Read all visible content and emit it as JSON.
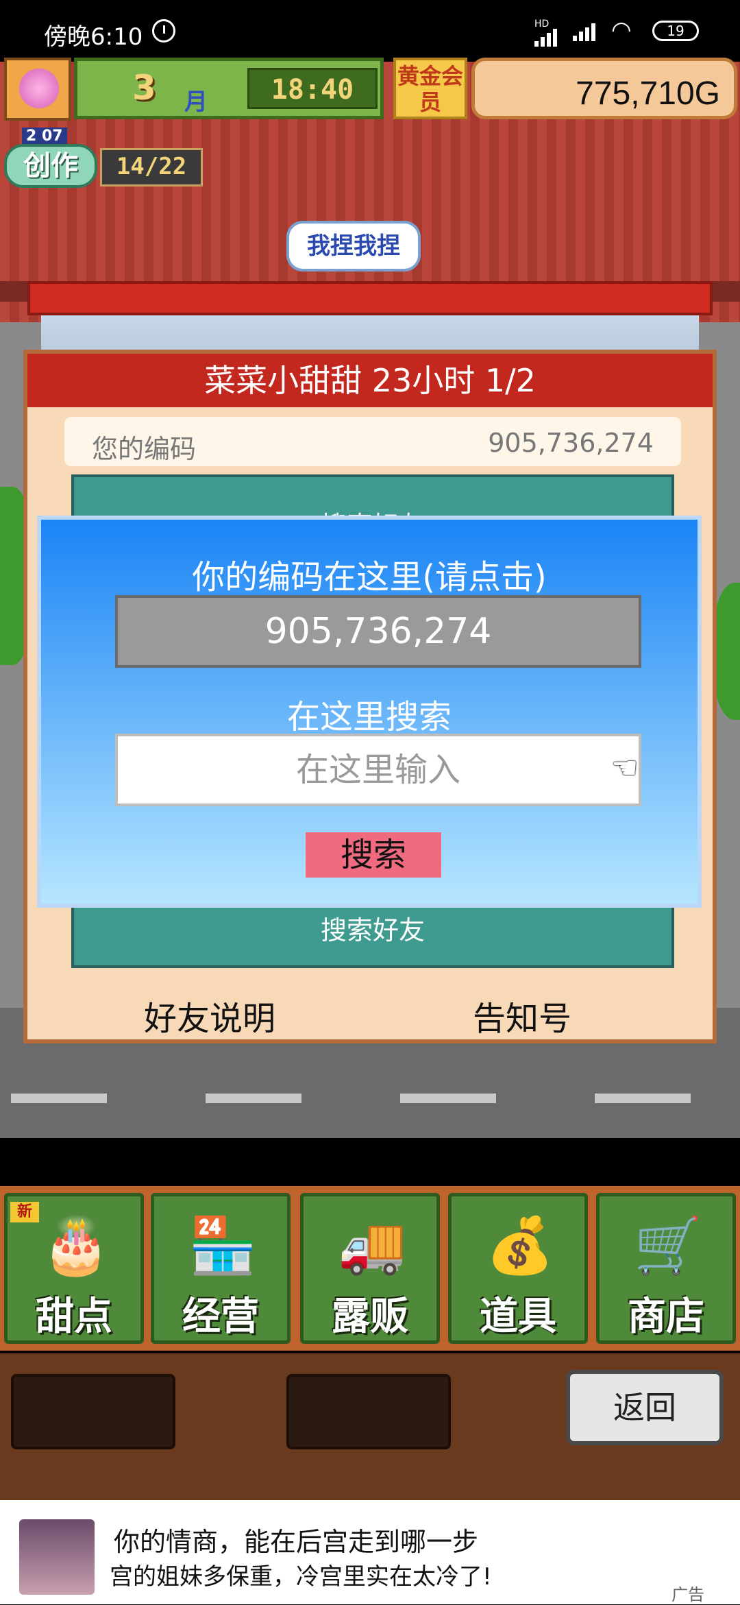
{
  "status_bar": {
    "time": "傍晚6:10",
    "network": "HD",
    "battery": "19"
  },
  "hud": {
    "month": "3",
    "month_unit": "月",
    "clock": "18:40",
    "gold_badge": "黄金会员",
    "money": "775,710G"
  },
  "create": {
    "year_label": "2 07",
    "label": "创作",
    "progress": "14/22"
  },
  "bubble": "我捏我捏",
  "panel": {
    "header": "菜菜小甜甜  23小时 1/2",
    "code_label": "您的编码",
    "code_value": "905,736,274",
    "teal_top": "搜索好友",
    "teal_bottom": "搜索好友",
    "tab_friend": "好友说明",
    "tab_notice": "告知号"
  },
  "dialog": {
    "title": "你的编码在这里(请点击)",
    "code": "905,736,274",
    "search_label": "在这里搜索",
    "search_placeholder": "在这里输入",
    "search_button": "搜索"
  },
  "menu": {
    "items": [
      {
        "label": "甜点",
        "icon": "cake-icon",
        "glyph": "🎂"
      },
      {
        "label": "经营",
        "icon": "shop-icon",
        "glyph": "🏪"
      },
      {
        "label": "露贩",
        "icon": "truck-icon",
        "glyph": "🚚"
      },
      {
        "label": "道具",
        "icon": "bag-icon",
        "glyph": "💰"
      },
      {
        "label": "商店",
        "icon": "cart-icon",
        "glyph": "🛒"
      }
    ],
    "new_badge": "新"
  },
  "bottom": {
    "back_button": "返回"
  },
  "ad": {
    "line1": "你的情商，能在后宫走到哪一步",
    "line2": "宫的姐妹多保重，冷宫里实在太冷了!",
    "tag": "广告"
  }
}
